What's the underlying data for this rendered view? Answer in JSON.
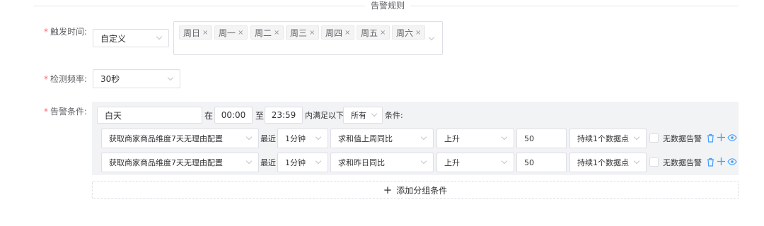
{
  "section": {
    "title": "告警规则"
  },
  "trigger_time": {
    "label": "触发时间:",
    "mode": "自定义",
    "days": [
      "周日",
      "周一",
      "周二",
      "周三",
      "周四",
      "周五",
      "周六"
    ],
    "remove_glyph": "×"
  },
  "frequency": {
    "label": "检测频率:",
    "value": "30秒"
  },
  "conditions": {
    "label": "告警条件:",
    "period_name": "白天",
    "in_text": "在",
    "start_time": "00:00",
    "to_text": "至",
    "end_time": "23:59",
    "within_text": "内满足以下",
    "match_mode": "所有",
    "suffix": "条件:",
    "rows": [
      {
        "metric": "获取商家商品维度7天无理由配置",
        "recent_label": "最近",
        "window": "1分钟",
        "aggregation": "求和值上周同比",
        "direction": "上升",
        "threshold": "50",
        "duration": "持续1个数据点",
        "no_data_label": "无数据告警"
      },
      {
        "metric": "获取商家商品维度7天无理由配置",
        "recent_label": "最近",
        "window": "1分钟",
        "aggregation": "求和昨日同比",
        "direction": "上升",
        "threshold": "50",
        "duration": "持续1个数据点",
        "no_data_label": "无数据告警"
      }
    ],
    "add_group_label": "添加分组条件",
    "add_group_glyph": "+",
    "row_icons": {
      "delete": "trash-icon",
      "add": "plus-icon",
      "view": "eye-icon"
    }
  },
  "colors": {
    "accent": "#409eff",
    "required": "#f56c6c",
    "border": "#dcdfe6",
    "panel": "#f2f3f5"
  }
}
